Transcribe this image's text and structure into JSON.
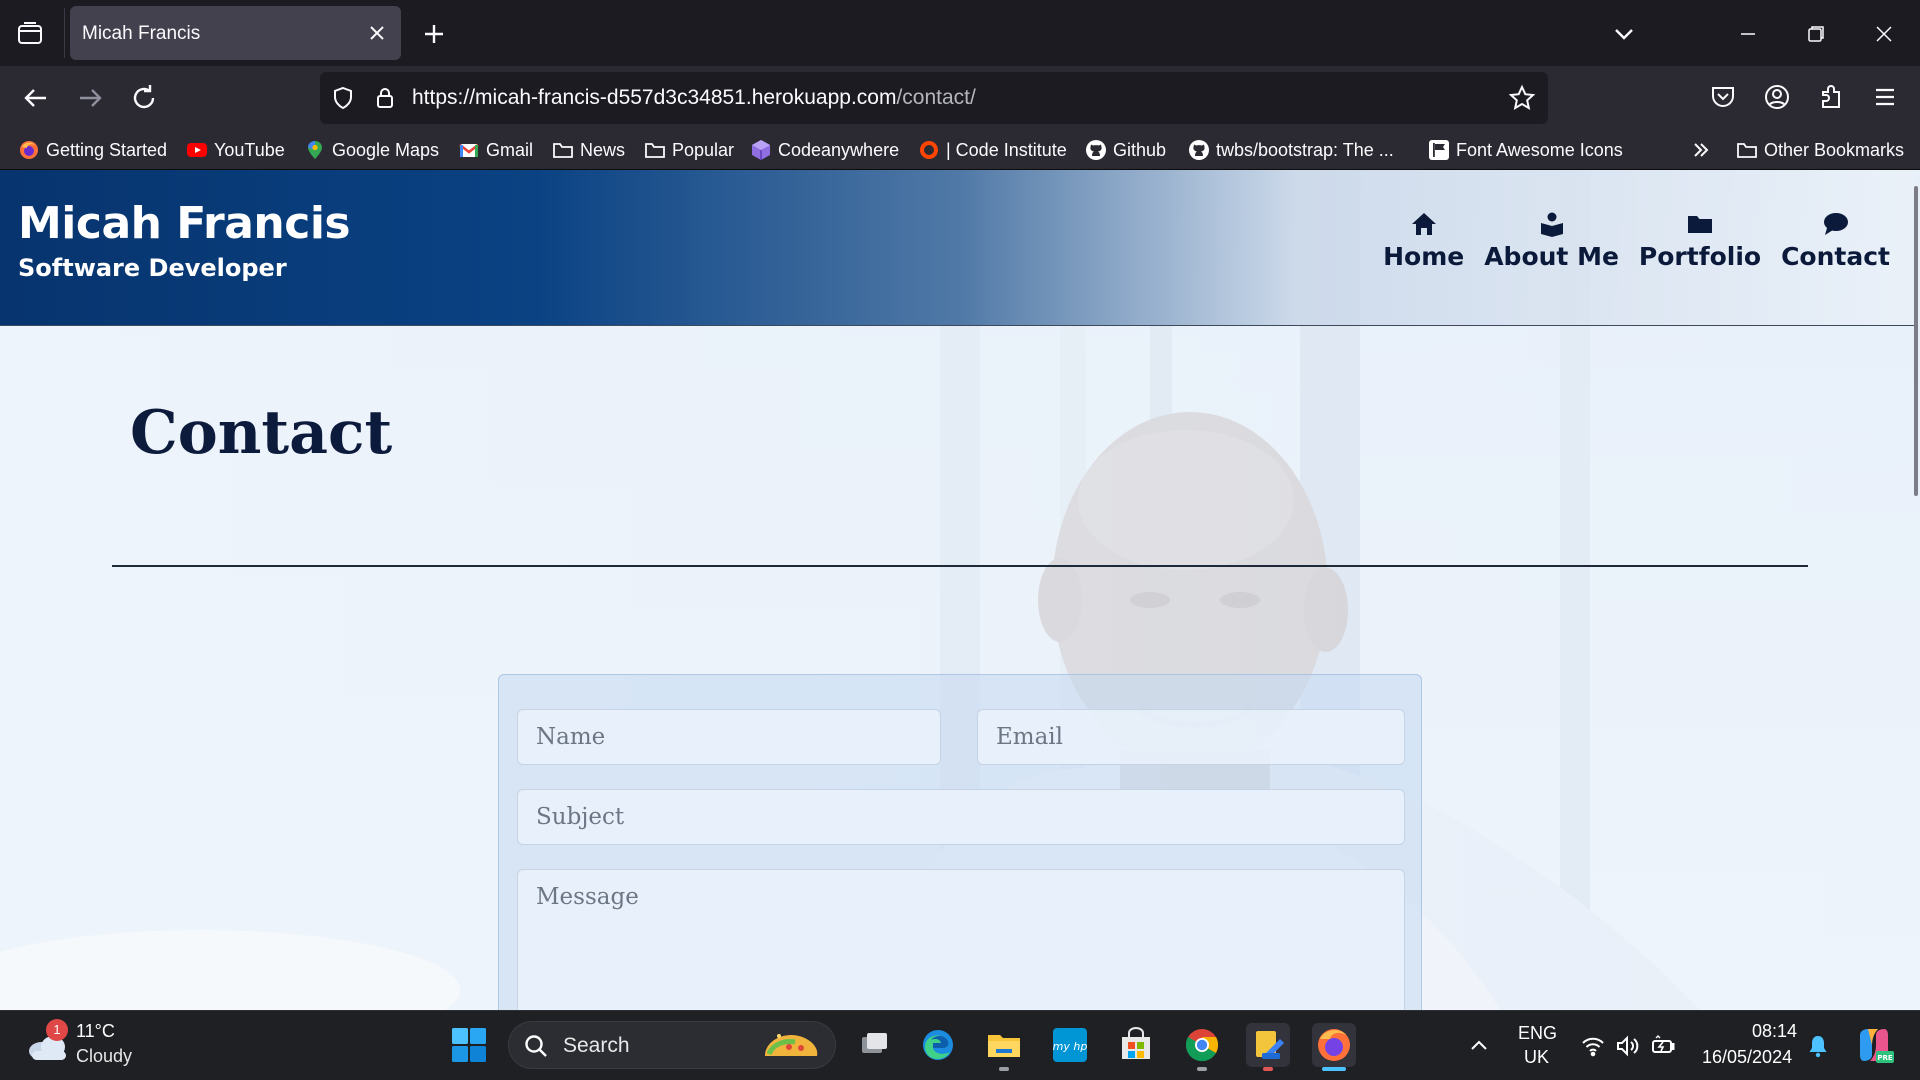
{
  "browser": {
    "tab_title": "Micah Francis",
    "url_host": "https://micah-francis-d557d3c34851.herokuapp.com",
    "url_path": "/contact/",
    "bookmarks": [
      {
        "label": "Getting Started",
        "icon": "firefox-icon"
      },
      {
        "label": "YouTube",
        "icon": "youtube-icon"
      },
      {
        "label": "Google Maps",
        "icon": "maps-pin-icon"
      },
      {
        "label": "Gmail",
        "icon": "gmail-icon"
      },
      {
        "label": "News",
        "icon": "folder-icon"
      },
      {
        "label": "Popular",
        "icon": "folder-icon"
      },
      {
        "label": "Codeanywhere",
        "icon": "codeanywhere-icon"
      },
      {
        "label": "| Code Institute",
        "icon": "code-institute-icon"
      },
      {
        "label": "Github",
        "icon": "github-icon"
      },
      {
        "label": "twbs/bootstrap: The ...",
        "icon": "github-icon"
      },
      {
        "label": "Font Awesome Icons",
        "icon": "flag-icon"
      }
    ],
    "other_bookmarks": "Other Bookmarks"
  },
  "site": {
    "brand_name": "Micah Francis",
    "brand_subtitle": "Software Developer",
    "nav": [
      {
        "label": "Home",
        "icon": "home-icon"
      },
      {
        "label": "About Me",
        "icon": "user-book-icon"
      },
      {
        "label": "Portfolio",
        "icon": "folder-icon"
      },
      {
        "label": "Contact",
        "icon": "chat-bubble-icon"
      }
    ],
    "page_heading": "Contact",
    "form": {
      "name_placeholder": "Name",
      "email_placeholder": "Email",
      "subject_placeholder": "Subject",
      "message_placeholder": "Message"
    }
  },
  "taskbar": {
    "weather_badge": "1",
    "weather_temp": "11°C",
    "weather_desc": "Cloudy",
    "search_label": "Search",
    "lang_line1": "ENG",
    "lang_line2": "UK",
    "time": "08:14",
    "date": "16/05/2024"
  },
  "colors": {
    "browser_bg": "#1c1b22",
    "toolbar_bg": "#2b2a33",
    "header_blue": "#07346e",
    "nav_text": "#0b1a3a",
    "taskbar_bg": "#1f2024"
  }
}
